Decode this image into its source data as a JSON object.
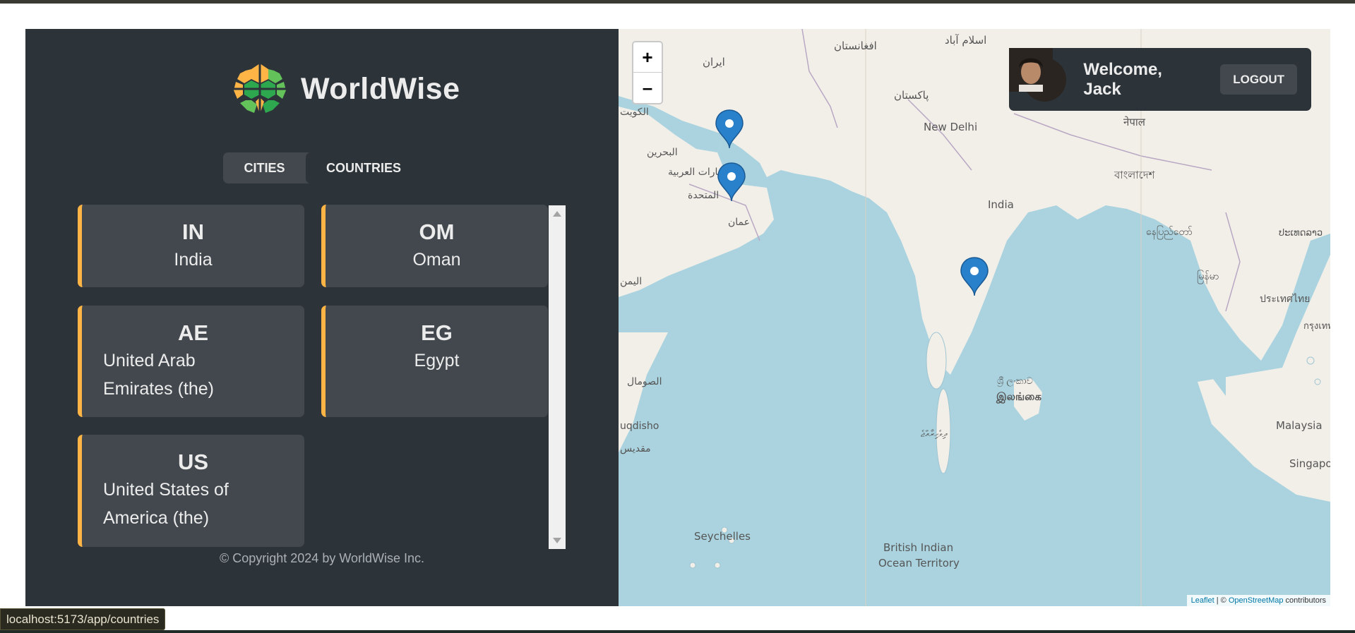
{
  "app": {
    "name": "WorldWise"
  },
  "tabs": [
    {
      "label": "CITIES",
      "active": false
    },
    {
      "label": "COUNTRIES",
      "active": true
    }
  ],
  "countries": [
    {
      "code": "IN",
      "name": "India"
    },
    {
      "code": "OM",
      "name": "Oman"
    },
    {
      "code": "AE",
      "name_line1": "United Arab",
      "name_line2": "Emirates (the)"
    },
    {
      "code": "EG",
      "name": "Egypt"
    },
    {
      "code": "US",
      "name_line1": "United States of",
      "name_line2": "America (the)"
    }
  ],
  "footer": {
    "copyright": "© Copyright 2024 by WorldWise Inc."
  },
  "user": {
    "welcome": "Welcome, Jack",
    "logout_label": "LOGOUT"
  },
  "map": {
    "zoom_in": "+",
    "zoom_out": "–",
    "attribution_leaflet": "Leaflet",
    "attribution_sep": " | © ",
    "attribution_osm": "OpenStreetMap",
    "attribution_suffix": " contributors",
    "labels": {
      "afghanistan": "افغانستان",
      "islamabad": "اسلام آباد",
      "iran": "ایران",
      "pakistan": "پاکستان",
      "kuwait": "الكويت",
      "bahrain": "البحرين",
      "uae": "الإمارات العربية",
      "uae2": "المتحدة",
      "oman": "عمان",
      "yemen": "اليمن",
      "somalia": "الصومال",
      "mogadishu": "uqdisho",
      "mogadishu_ar": "مقديس",
      "new_delhi": "New Delhi",
      "india": "India",
      "nepal": "नेपाल",
      "bangladesh": "বাংলাদেশ",
      "myanmar": "နေပြည်တော်",
      "myanmar2": "မြန်မာ",
      "laos": "ປະເທດລາວ",
      "thailand": "ประเทศไทย",
      "bangkok": "กรุงเทพฯ",
      "srilanka": "ශ්‍රී ලංකාව",
      "srilanka2": "இலங்கை",
      "maldives": "ދިވެހިރާއްޖެ",
      "seychelles": "Seychelles",
      "biot1": "British Indian",
      "biot2": "Ocean Territory",
      "malaysia": "Malaysia",
      "singapore": "Singapore"
    }
  },
  "status_url": "localhost:5173/app/countries",
  "colors": {
    "accent": "#ffb545",
    "panel": "#2d3439",
    "card": "#42484d",
    "text": "#ececec",
    "water": "#aad3df",
    "land": "#f2efe9",
    "marker": "#2a81cb"
  }
}
